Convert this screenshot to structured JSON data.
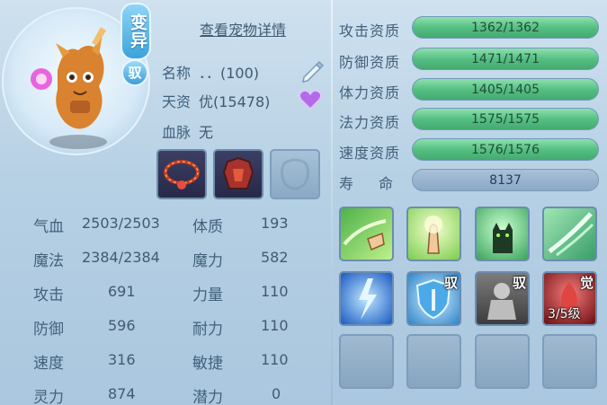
{
  "header": {
    "variant_badge": "变异",
    "yu_badge": "驭",
    "view_details_link": "查看宠物详情"
  },
  "pet": {
    "name_label": "名称",
    "name_value": "．．(100)",
    "talent_label": "天资",
    "talent_value": "优(15478)",
    "bloodline_label": "血脉",
    "bloodline_value": "无"
  },
  "stats": [
    {
      "label": "气血",
      "value": "2503/2503"
    },
    {
      "label": "体质",
      "value": "193"
    },
    {
      "label": "魔法",
      "value": "2384/2384"
    },
    {
      "label": "魔力",
      "value": "582"
    },
    {
      "label": "攻击",
      "value": "691"
    },
    {
      "label": "力量",
      "value": "110"
    },
    {
      "label": "防御",
      "value": "596"
    },
    {
      "label": "耐力",
      "value": "110"
    },
    {
      "label": "速度",
      "value": "316"
    },
    {
      "label": "敏捷",
      "value": "110"
    },
    {
      "label": "灵力",
      "value": "874"
    },
    {
      "label": "潜力",
      "value": "0"
    }
  ],
  "aptitudes": [
    {
      "label": "攻击资质",
      "value": "1362/1362"
    },
    {
      "label": "防御资质",
      "value": "1471/1471"
    },
    {
      "label": "体力资质",
      "value": "1405/1405"
    },
    {
      "label": "法力资质",
      "value": "1575/1575"
    },
    {
      "label": "速度资质",
      "value": "1576/1576"
    }
  ],
  "lifespan": {
    "label": "寿　命",
    "value": "8137"
  },
  "skills": {
    "row2_tags": [
      "驭",
      "驭",
      "觉"
    ],
    "awaken_level": "3/5级"
  },
  "colors": {
    "bar_green": "#55c082",
    "bar_gray": "#8ba8c6",
    "background": "#b6d0e4"
  },
  "icons": {
    "edit": "pencil-icon",
    "favorite": "heart-icon"
  }
}
